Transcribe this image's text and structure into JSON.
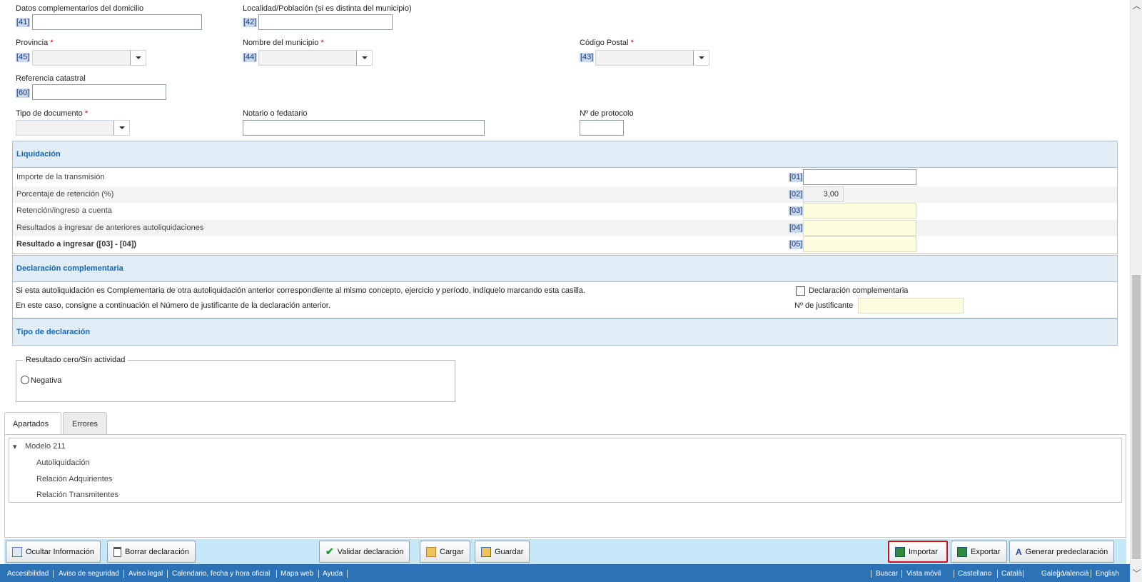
{
  "address": {
    "datos_label": "Datos complementarios del domicilio",
    "datos_code": "[41]",
    "localidad_label": "Localidad/Población (si es distinta del municipio)",
    "localidad_code": "[42]",
    "provincia_label": "Provincia",
    "provincia_code": "[45]",
    "municipio_label": "Nombre del municipio",
    "municipio_code": "[44]",
    "cp_label": "Código Postal",
    "cp_code": "[43]",
    "catastral_label": "Referencia catastral",
    "catastral_code": "[60]",
    "tipo_doc_label": "Tipo de documento",
    "notario_label": "Notario o fedatario",
    "protocolo_label": "Nº de protocolo",
    "required_mark": "*"
  },
  "liquidacion": {
    "title": "Liquidación",
    "rows": [
      {
        "label": "Importe de la transmisión",
        "code": "[01]",
        "value": ""
      },
      {
        "label": "Porcentaje de retención (%)",
        "code": "[02]",
        "value": "3,00"
      },
      {
        "label": "Retención/ingreso a cuenta",
        "code": "[03]",
        "value": ""
      },
      {
        "label": "Resultados a ingresar de anteriores autoliquidaciones",
        "code": "[04]",
        "value": ""
      },
      {
        "label": "Resultado a ingresar ([03] - [04])",
        "code": "[05]",
        "value": ""
      }
    ]
  },
  "complementaria": {
    "title": "Declaración complementaria",
    "text1": "Si esta autoliquidación es Complementaria de otra autoliquidación anterior correspondiente al mismo concepto, ejercicio y período, indíquelo marcando esta casilla.",
    "text2": "En este caso, consigne a continuación el Número de justificante de la declaración anterior.",
    "checkbox_label": "Declaración complementaria",
    "justificante_label": "Nº de justificante"
  },
  "tipo_declaracion": {
    "title": "Tipo de declaración",
    "fieldset_legend": "Resultado cero/Sin actividad",
    "radio_label": "Negativa"
  },
  "tabs": [
    {
      "label": "Apartados"
    },
    {
      "label": "Errores"
    }
  ],
  "tree": {
    "root": "Modelo 211",
    "children": [
      "Autoliquidación",
      "Relación Adquirientes",
      "Relación Transmitentes"
    ]
  },
  "toolbar": {
    "ocultar": "Ocultar Información",
    "borrar": "Borrar declaración",
    "validar": "Validar declaración",
    "cargar": "Cargar",
    "guardar": "Guardar",
    "importar": "Importar",
    "exportar": "Exportar",
    "generar": "Generar predeclaración"
  },
  "footer": {
    "left": [
      "Accesibilidad",
      "Aviso de seguridad",
      "Aviso legal",
      "Calendario, fecha y hora oficial",
      "Mapa web",
      "Ayuda"
    ],
    "right": [
      "Buscar",
      "Vista móvil",
      "Castellano",
      "Català",
      "Galego",
      "Valencià",
      "English"
    ]
  },
  "colors": {
    "section_title": "#1565b5",
    "footer_bg": "#2b73b6",
    "highlight_border": "#d0111b"
  }
}
